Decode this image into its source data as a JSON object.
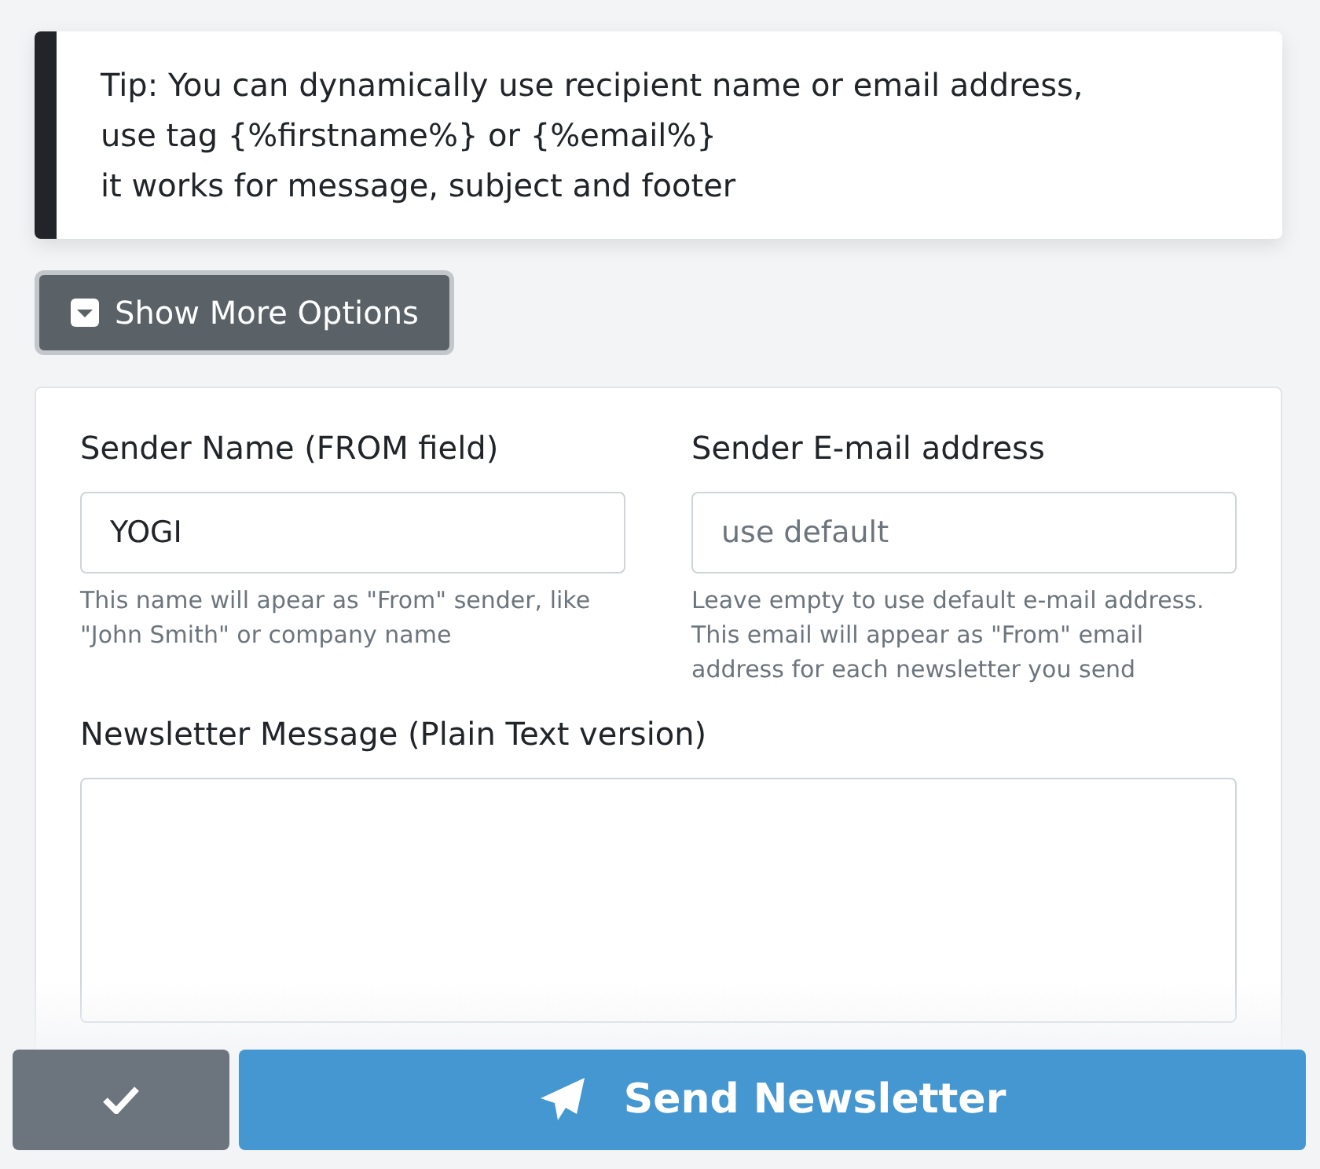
{
  "tip": {
    "lines": [
      "Tip: You can dynamically use recipient name or email address,",
      "use tag {%firstname%} or {%email%}",
      "it works for message, subject and footer"
    ]
  },
  "more_options": {
    "label": "Show More Options",
    "expanded": false
  },
  "form": {
    "fields": [
      {
        "label": "Sender Name (FROM field)",
        "value": "YOGI",
        "help": "This name will apear as \"From\" sender, like \"John Smith\" or company name"
      },
      {
        "label": "Sender E-mail address",
        "placeholder": "use default",
        "help": "Leave empty to use default e-mail address. This email will appear as \"From\" email address for each newsletter you send"
      }
    ],
    "message": {
      "label": "Newsletter Message (Plain Text version)"
    }
  },
  "footer": {
    "send_label": "Send Newsletter"
  }
}
